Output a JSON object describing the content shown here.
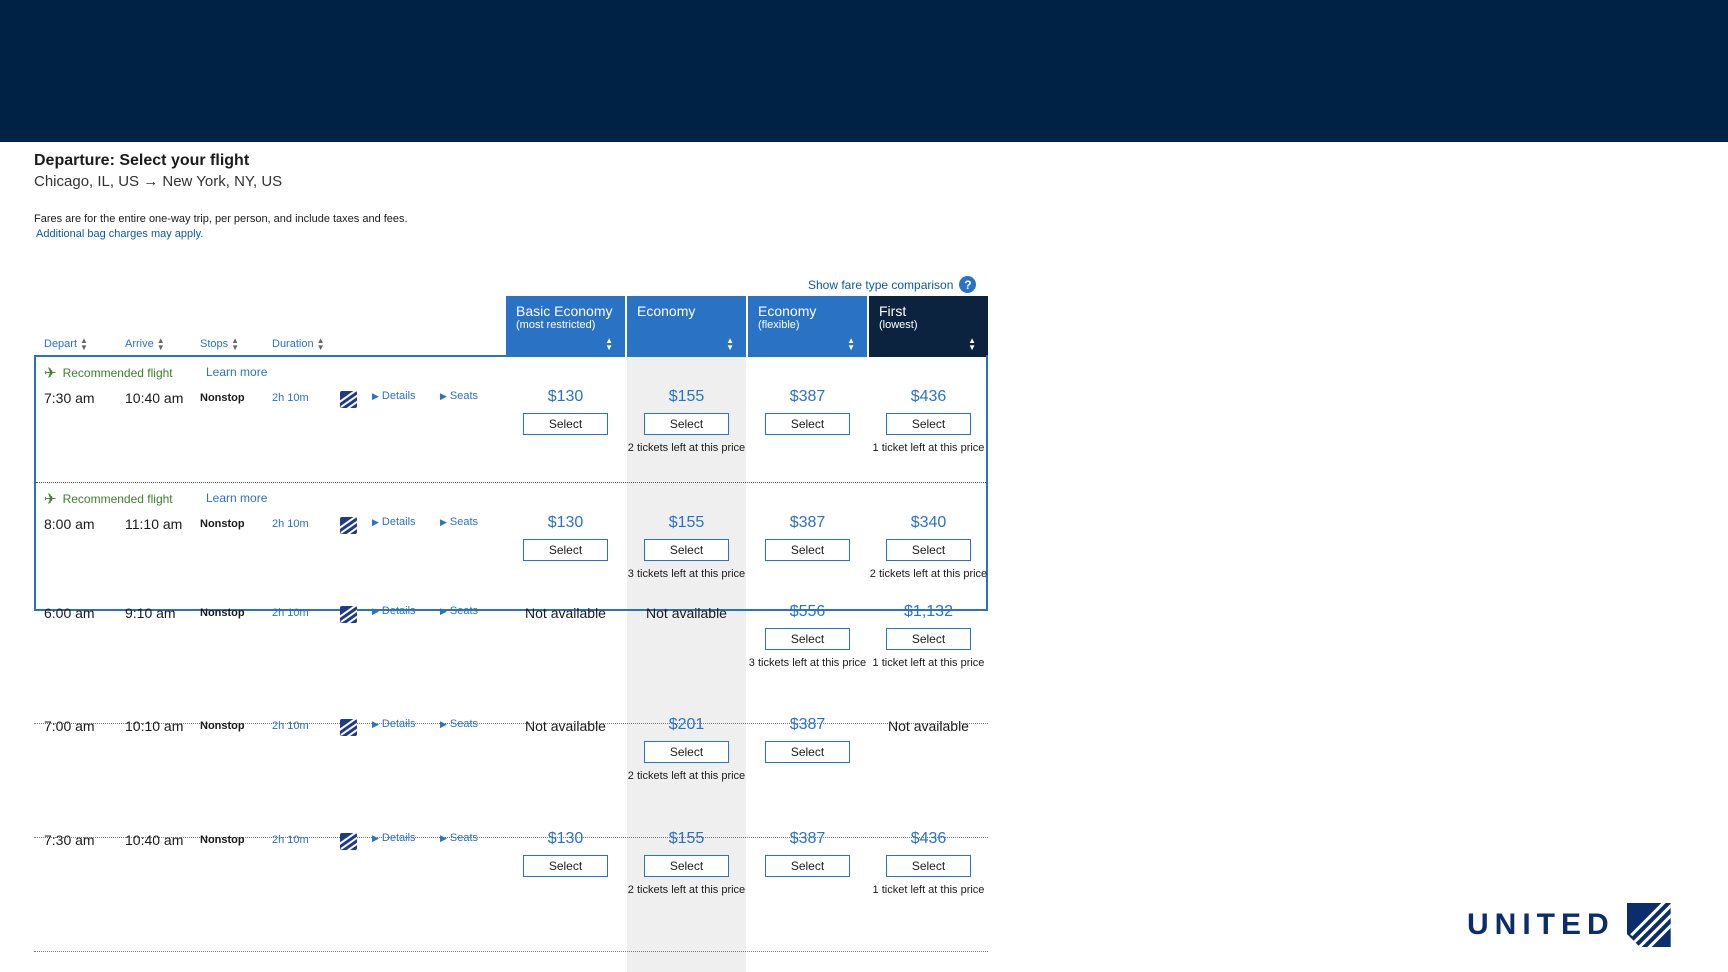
{
  "header": {
    "title": "Departure: Select your flight",
    "route": "Chicago, IL, US → New York, NY, US",
    "fares_note": "Fares are for the entire one-way trip, per person, and include taxes and fees.",
    "bag_link": "Additional bag charges may apply.",
    "compare_link": "Show fare type comparison",
    "help_icon": "?"
  },
  "sort_columns": [
    "Depart",
    "Arrive",
    "Stops",
    "Duration"
  ],
  "fare_columns": [
    {
      "title": "Basic Economy",
      "sub": "(most restricted)"
    },
    {
      "title": "Economy",
      "sub": ""
    },
    {
      "title": "Economy",
      "sub": "(flexible)"
    },
    {
      "title": "First",
      "sub": "(lowest)"
    }
  ],
  "recommended": {
    "label": "Recommended flight",
    "learn_more": "Learn more"
  },
  "row_links": {
    "details": "Details",
    "seats": "Seats",
    "select": "Select",
    "not_available": "Not available"
  },
  "flights": [
    {
      "depart": "7:30 am",
      "arrive": "10:40 am",
      "stops": "Nonstop",
      "duration": "2h 10m",
      "recommended": true,
      "fares": [
        {
          "price": "$130",
          "note": ""
        },
        {
          "price": "$155",
          "note": "2 tickets left at this price"
        },
        {
          "price": "$387",
          "note": ""
        },
        {
          "price": "$436",
          "note": "1 ticket left at this price"
        }
      ]
    },
    {
      "depart": "8:00 am",
      "arrive": "11:10 am",
      "stops": "Nonstop",
      "duration": "2h 10m",
      "recommended": true,
      "fares": [
        {
          "price": "$130",
          "note": ""
        },
        {
          "price": "$155",
          "note": "3 tickets left at this price"
        },
        {
          "price": "$387",
          "note": ""
        },
        {
          "price": "$340",
          "note": "2 tickets left at this price"
        }
      ]
    },
    {
      "depart": "6:00 am",
      "arrive": "9:10 am",
      "stops": "Nonstop",
      "duration": "2h 10m",
      "recommended": false,
      "fares": [
        {
          "price": null,
          "note": ""
        },
        {
          "price": null,
          "note": ""
        },
        {
          "price": "$556",
          "note": "3 tickets left at this price"
        },
        {
          "price": "$1,132",
          "note": "1 ticket left at this price"
        }
      ]
    },
    {
      "depart": "7:00 am",
      "arrive": "10:10 am",
      "stops": "Nonstop",
      "duration": "2h 10m",
      "recommended": false,
      "fares": [
        {
          "price": null,
          "note": ""
        },
        {
          "price": "$201",
          "note": "2 tickets left at this price"
        },
        {
          "price": "$387",
          "note": ""
        },
        {
          "price": null,
          "note": ""
        }
      ]
    },
    {
      "depart": "7:30 am",
      "arrive": "10:40 am",
      "stops": "Nonstop",
      "duration": "2h 10m",
      "recommended": false,
      "fares": [
        {
          "price": "$130",
          "note": ""
        },
        {
          "price": "$155",
          "note": "2 tickets left at this price"
        },
        {
          "price": "$387",
          "note": ""
        },
        {
          "price": "$436",
          "note": "1 ticket left at this price"
        }
      ]
    }
  ],
  "brand": {
    "logo_text": "UNITED",
    "color_navy": "#002244",
    "color_blue": "#2a72c4",
    "color_green": "#3c7f2a"
  }
}
